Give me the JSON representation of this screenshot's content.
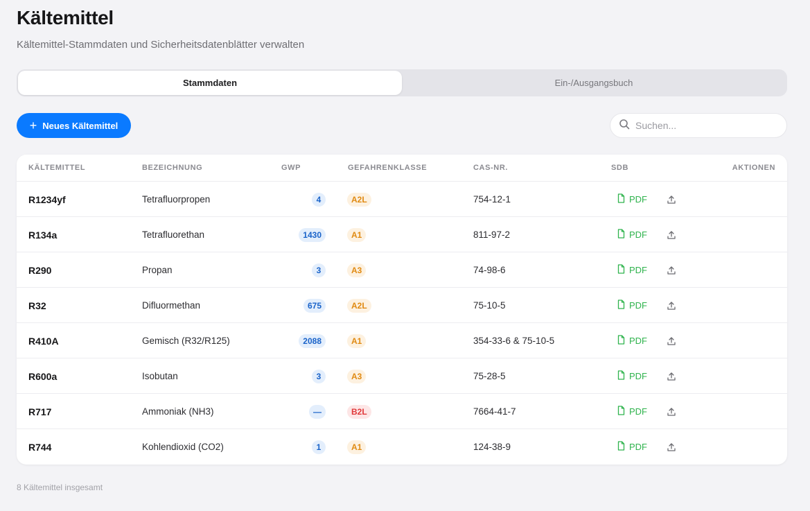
{
  "page": {
    "title": "Kältemittel",
    "subtitle": "Kältemittel-Stammdaten und Sicherheitsdatenblätter verwalten"
  },
  "tabs": [
    {
      "label": "Stammdaten",
      "active": true
    },
    {
      "label": "Ein-/Ausgangsbuch",
      "active": false
    }
  ],
  "toolbar": {
    "new_button_label": "Neues Kältemittel",
    "search_placeholder": "Suchen...",
    "search_value": ""
  },
  "table": {
    "columns": [
      "KÄLTEMITTEL",
      "BEZEICHNUNG",
      "GWP",
      "GEFAHRENKLASSE",
      "CAS-NR.",
      "SDB",
      "AKTIONEN"
    ],
    "rows": [
      {
        "code": "R1234yf",
        "name": "Tetrafluorpropen",
        "gwp": "4",
        "class": "A2L",
        "cas": "754-12-1",
        "sdb": "PDF"
      },
      {
        "code": "R134a",
        "name": "Tetrafluorethan",
        "gwp": "1430",
        "class": "A1",
        "cas": "811-97-2",
        "sdb": "PDF"
      },
      {
        "code": "R290",
        "name": "Propan",
        "gwp": "3",
        "class": "A3",
        "cas": "74-98-6",
        "sdb": "PDF"
      },
      {
        "code": "R32",
        "name": "Difluormethan",
        "gwp": "675",
        "class": "A2L",
        "cas": "75-10-5",
        "sdb": "PDF"
      },
      {
        "code": "R410A",
        "name": "Gemisch (R32/R125)",
        "gwp": "2088",
        "class": "A1",
        "cas": "354-33-6 & 75-10-5",
        "sdb": "PDF"
      },
      {
        "code": "R600a",
        "name": "Isobutan",
        "gwp": "3",
        "class": "A3",
        "cas": "75-28-5",
        "sdb": "PDF"
      },
      {
        "code": "R717",
        "name": "Ammoniak (NH3)",
        "gwp": "—",
        "class": "B2L",
        "cas": "7664-41-7",
        "sdb": "PDF"
      },
      {
        "code": "R744",
        "name": "Kohlendioxid (CO2)",
        "gwp": "1",
        "class": "A1",
        "cas": "124-38-9",
        "sdb": "PDF"
      }
    ]
  },
  "class_colors": {
    "A1": {
      "bg": "#fdf1e0",
      "fg": "#e08a12"
    },
    "A2L": {
      "bg": "#fdf1e0",
      "fg": "#e08a12"
    },
    "A3": {
      "bg": "#fdf1e0",
      "fg": "#e08a12"
    },
    "B2L": {
      "bg": "#fde6e6",
      "fg": "#e0393b"
    }
  },
  "icons": {
    "new_button": "plus-icon",
    "search": "search-icon",
    "sdb": "document-icon",
    "upload": "upload-icon"
  },
  "colors": {
    "accent": "#0a7aff",
    "pdf": "#2fb34d",
    "gwp_badge_bg": "#e3eefc",
    "gwp_badge_fg": "#1a63c9"
  },
  "footer": {
    "count_text": "8 Kältemittel insgesamt"
  }
}
